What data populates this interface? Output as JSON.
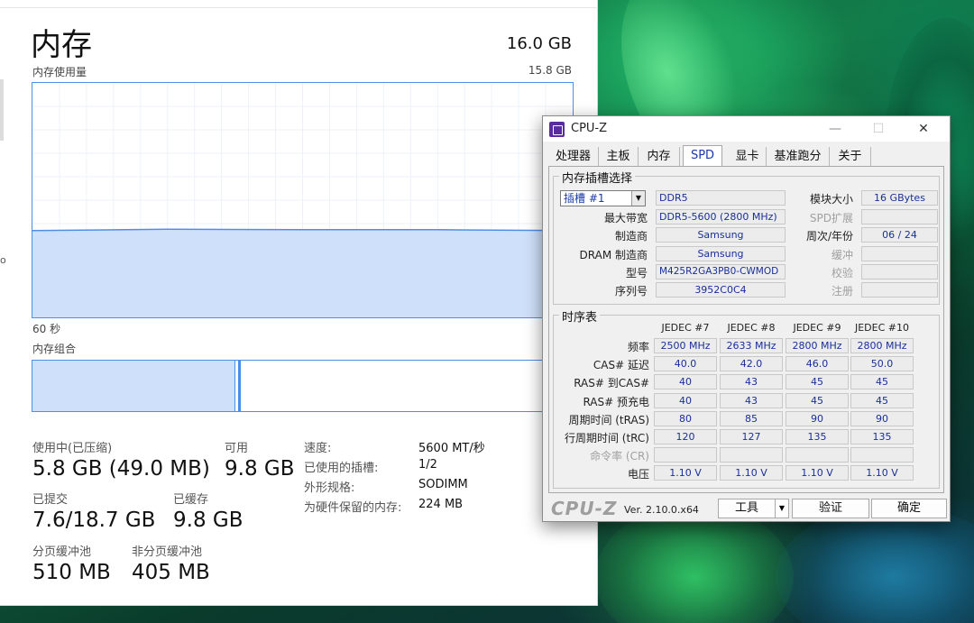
{
  "taskmgr": {
    "title": "内存",
    "total": "16.0 GB",
    "graph_label": "内存使用量",
    "graph_max": "15.8 GB",
    "time_span": "60 秒",
    "composition_label": "内存组合",
    "usage_fraction": 0.37,
    "composition_used_fraction": 0.375,
    "stats": {
      "in_use_label": "使用中(已压缩)",
      "in_use_value": "5.8 GB (49.0 MB)",
      "available_label": "可用",
      "available_value": "9.8 GB",
      "committed_label": "已提交",
      "committed_value": "7.6/18.7 GB",
      "cached_label": "已缓存",
      "cached_value": "9.8 GB",
      "paged_label": "分页缓冲池",
      "paged_value": "510 MB",
      "nonpaged_label": "非分页缓冲池",
      "nonpaged_value": "405 MB"
    },
    "meta": {
      "speed_label": "速度:",
      "speed_value": "5600 MT/秒",
      "slots_label": "已使用的插槽:",
      "slots_value": "1/2",
      "form_label": "外形规格:",
      "form_value": "SODIMM",
      "reserved_label": "为硬件保留的内存:",
      "reserved_value": "224 MB"
    },
    "edge_text": "o"
  },
  "cpuz": {
    "title": "CPU-Z",
    "controls": {
      "minimize": "—",
      "maximize": "☐",
      "close": "✕"
    },
    "tabs": [
      "处理器",
      "主板",
      "内存",
      "SPD",
      "显卡",
      "基准跑分",
      "关于"
    ],
    "active_tab": "SPD",
    "slot_group": {
      "title": "内存插槽选择",
      "slot_value": "插槽 #1",
      "type": "DDR5",
      "module_size_label": "模块大小",
      "module_size": "16 GBytes",
      "max_bw_label": "最大带宽",
      "max_bw": "DDR5-5600 (2800 MHz)",
      "spd_ext_label": "SPD扩展",
      "spd_ext": "",
      "manufacturer_label": "制造商",
      "manufacturer": "Samsung",
      "week_year_label": "周次/年份",
      "week_year": "06 / 24",
      "dram_mfr_label": "DRAM 制造商",
      "dram_mfr": "Samsung",
      "buffered_label": "缓冲",
      "buffered": "",
      "part_label": "型号",
      "part": "M425R2GA3PB0-CWMOD",
      "correction_label": "校验",
      "correction": "",
      "serial_label": "序列号",
      "serial": "3952C0C4",
      "registered_label": "注册",
      "registered": ""
    },
    "timings": {
      "title": "时序表",
      "headers": [
        "JEDEC #7",
        "JEDEC #8",
        "JEDEC #9",
        "JEDEC #10"
      ],
      "rows": [
        {
          "label": "频率",
          "values": [
            "2500 MHz",
            "2633 MHz",
            "2800 MHz",
            "2800 MHz"
          ],
          "dim": false
        },
        {
          "label": "CAS# 延迟",
          "values": [
            "40.0",
            "42.0",
            "46.0",
            "50.0"
          ],
          "dim": false
        },
        {
          "label": "RAS# 到CAS#",
          "values": [
            "40",
            "43",
            "45",
            "45"
          ],
          "dim": false
        },
        {
          "label": "RAS# 预充电",
          "values": [
            "40",
            "43",
            "45",
            "45"
          ],
          "dim": false
        },
        {
          "label": "周期时间 (tRAS)",
          "values": [
            "80",
            "85",
            "90",
            "90"
          ],
          "dim": false
        },
        {
          "label": "行周期时间 (tRC)",
          "values": [
            "120",
            "127",
            "135",
            "135"
          ],
          "dim": false
        },
        {
          "label": "命令率 (CR)",
          "values": [
            "",
            "",
            "",
            ""
          ],
          "dim": true
        },
        {
          "label": "电压",
          "values": [
            "1.10 V",
            "1.10 V",
            "1.10 V",
            "1.10 V"
          ],
          "dim": false
        }
      ]
    },
    "footer": {
      "brand": "CPU-Z",
      "version": "Ver. 2.10.0.x64",
      "tools_button": "工具",
      "validate_button": "验证",
      "ok_button": "确定"
    }
  }
}
